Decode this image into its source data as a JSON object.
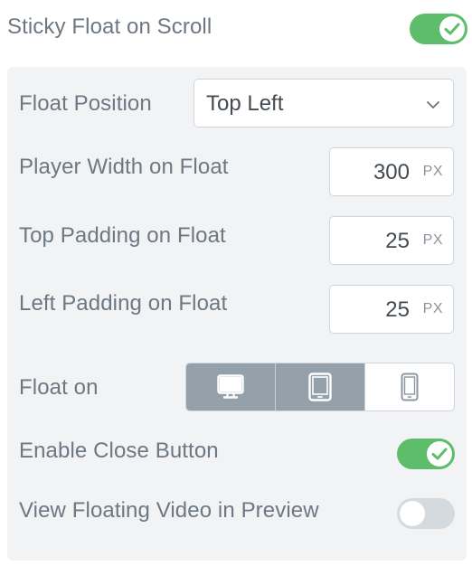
{
  "sticky": {
    "label": "Sticky Float on Scroll",
    "enabled": true
  },
  "float_position": {
    "label": "Float Position",
    "value": "Top Left"
  },
  "player_width": {
    "label": "Player Width on Float",
    "value": "300",
    "unit": "PX"
  },
  "top_padding": {
    "label": "Top Padding on Float",
    "value": "25",
    "unit": "PX"
  },
  "left_padding": {
    "label": "Left Padding on Float",
    "value": "25",
    "unit": "PX"
  },
  "float_on": {
    "label": "Float on",
    "devices": [
      {
        "icon": "desktop-icon",
        "active": true
      },
      {
        "icon": "tablet-icon",
        "active": true
      },
      {
        "icon": "mobile-icon",
        "active": false
      }
    ]
  },
  "close_button": {
    "label": "Enable Close Button",
    "enabled": true
  },
  "preview": {
    "label": "View Floating Video in Preview",
    "enabled": false
  },
  "colors": {
    "toggle_on": "#5dbd6b",
    "toggle_off": "#d5dadf",
    "device_active": "#94a0aa",
    "label_text": "#6d7882",
    "panel_bg": "#f1f3f5"
  }
}
